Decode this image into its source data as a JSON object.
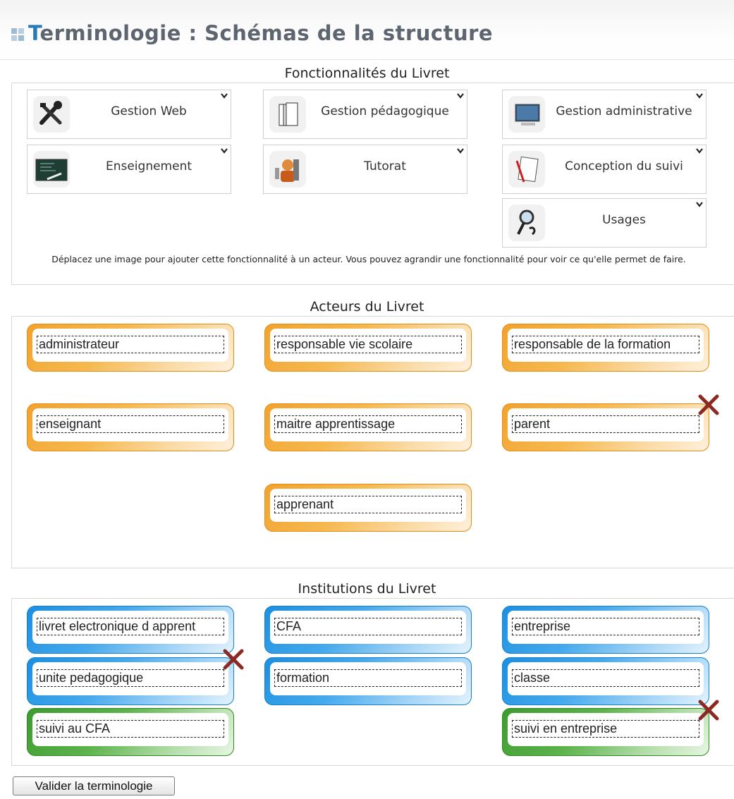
{
  "page": {
    "title": "Terminologie : Schémas de la structure",
    "title_first": "T",
    "title_rest": "erminologie : Schémas de la structure"
  },
  "features": {
    "heading": "Fonctionnalités du Livret",
    "items": [
      {
        "label": "Gestion Web",
        "icon": "tools-icon"
      },
      {
        "label": "Gestion pédagogique",
        "icon": "books-icon"
      },
      {
        "label": "Gestion administrative",
        "icon": "monitor-icon"
      },
      {
        "label": "Enseignement",
        "icon": "blackboard-icon"
      },
      {
        "label": "Tutorat",
        "icon": "tutor-icon"
      },
      {
        "label": "Conception du suivi",
        "icon": "pencil-paper-icon"
      },
      {
        "label": "Usages",
        "icon": "magnifier-icon"
      }
    ],
    "hint": "Déplacez une image pour ajouter cette fonctionnalité à un acteur. Vous pouvez agrandir une fonctionnalité pour voir ce qu'elle permet de faire."
  },
  "actors": {
    "heading": "Acteurs du Livret",
    "items": [
      {
        "value": "administrateur"
      },
      {
        "value": "responsable vie scolaire"
      },
      {
        "value": "responsable de la formation"
      },
      {
        "value": "enseignant"
      },
      {
        "value": "maitre apprentissage"
      },
      {
        "value": "parent"
      },
      {
        "value": "apprenant"
      }
    ]
  },
  "institutions": {
    "heading": "Institutions du Livret",
    "items": [
      {
        "value": "livret electronique d apprent"
      },
      {
        "value": "CFA"
      },
      {
        "value": "entreprise"
      },
      {
        "value": "unite pedagogique"
      },
      {
        "value": "formation"
      },
      {
        "value": "classe"
      },
      {
        "value": "suivi au CFA"
      },
      {
        "value": "suivi en entreprise"
      }
    ]
  },
  "actions": {
    "validate_label": "Valider la terminologie"
  },
  "colors": {
    "actor_frame": "#f1a22d",
    "institution_frame": "#1b8fe0",
    "followup_frame": "#3c9b2e",
    "delete_mark": "#8b2a22",
    "title_accent": "#2a7ab8"
  }
}
